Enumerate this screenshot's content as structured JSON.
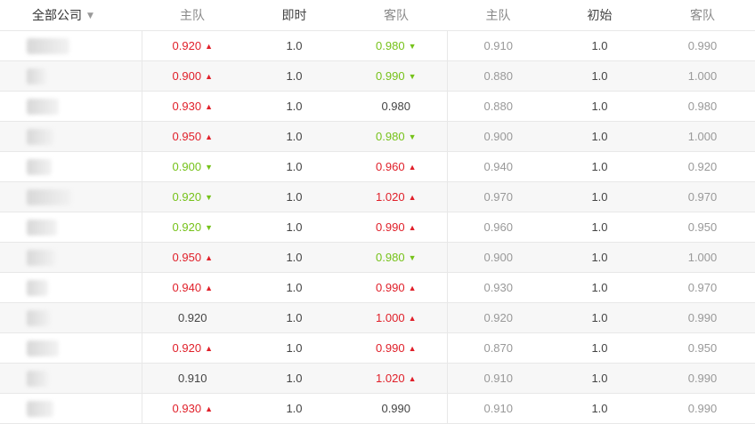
{
  "header": {
    "company_filter": "全部公司",
    "home_live": "主队",
    "draw_live": "即时",
    "away_live": "客队",
    "home_init": "主队",
    "draw_init": "初始",
    "away_init": "客队"
  },
  "colors": {
    "up": "#e0202a",
    "down": "#76c21a",
    "neutral": "#444444",
    "initial": "#999999"
  },
  "rows": [
    {
      "home": "0.920",
      "home_trend": "up",
      "draw": "1.0",
      "away": "0.980",
      "away_trend": "down",
      "init_home": "0.910",
      "init_draw": "1.0",
      "init_away": "0.990"
    },
    {
      "home": "0.900",
      "home_trend": "up",
      "draw": "1.0",
      "away": "0.990",
      "away_trend": "down",
      "init_home": "0.880",
      "init_draw": "1.0",
      "init_away": "1.000"
    },
    {
      "home": "0.930",
      "home_trend": "up",
      "draw": "1.0",
      "away": "0.980",
      "away_trend": "none",
      "init_home": "0.880",
      "init_draw": "1.0",
      "init_away": "0.980"
    },
    {
      "home": "0.950",
      "home_trend": "up",
      "draw": "1.0",
      "away": "0.980",
      "away_trend": "down",
      "init_home": "0.900",
      "init_draw": "1.0",
      "init_away": "1.000"
    },
    {
      "home": "0.900",
      "home_trend": "down",
      "draw": "1.0",
      "away": "0.960",
      "away_trend": "up",
      "init_home": "0.940",
      "init_draw": "1.0",
      "init_away": "0.920"
    },
    {
      "home": "0.920",
      "home_trend": "down",
      "draw": "1.0",
      "away": "1.020",
      "away_trend": "up",
      "init_home": "0.970",
      "init_draw": "1.0",
      "init_away": "0.970"
    },
    {
      "home": "0.920",
      "home_trend": "down",
      "draw": "1.0",
      "away": "0.990",
      "away_trend": "up",
      "init_home": "0.960",
      "init_draw": "1.0",
      "init_away": "0.950"
    },
    {
      "home": "0.950",
      "home_trend": "up",
      "draw": "1.0",
      "away": "0.980",
      "away_trend": "down",
      "init_home": "0.900",
      "init_draw": "1.0",
      "init_away": "1.000"
    },
    {
      "home": "0.940",
      "home_trend": "up",
      "draw": "1.0",
      "away": "0.990",
      "away_trend": "up",
      "init_home": "0.930",
      "init_draw": "1.0",
      "init_away": "0.970"
    },
    {
      "home": "0.920",
      "home_trend": "none",
      "draw": "1.0",
      "away": "1.000",
      "away_trend": "up",
      "init_home": "0.920",
      "init_draw": "1.0",
      "init_away": "0.990"
    },
    {
      "home": "0.920",
      "home_trend": "up",
      "draw": "1.0",
      "away": "0.990",
      "away_trend": "up",
      "init_home": "0.870",
      "init_draw": "1.0",
      "init_away": "0.950"
    },
    {
      "home": "0.910",
      "home_trend": "none",
      "draw": "1.0",
      "away": "1.020",
      "away_trend": "up",
      "init_home": "0.910",
      "init_draw": "1.0",
      "init_away": "0.990"
    },
    {
      "home": "0.930",
      "home_trend": "up",
      "draw": "1.0",
      "away": "0.990",
      "away_trend": "none",
      "init_home": "0.910",
      "init_draw": "1.0",
      "init_away": "0.990"
    }
  ]
}
